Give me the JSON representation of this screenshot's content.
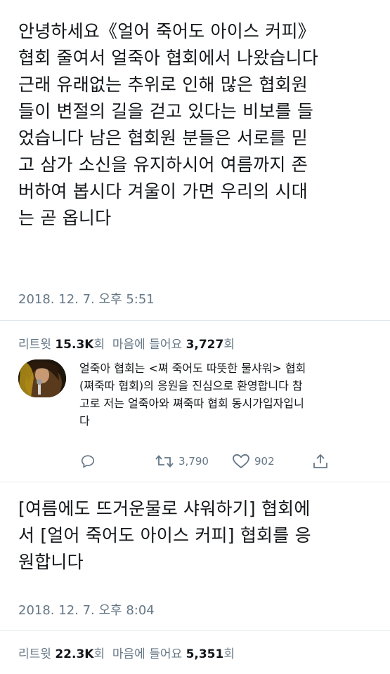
{
  "tweet1": {
    "lines": [
      "안녕하세요《얼어 죽어도 아이스 커피》",
      "협회 줄여서 얼죽아 협회에서 나왔습니다",
      "근래 유래없는 추위로 인해 많은 협회원",
      "들이 변절의 길을 걷고 있다는 비보를 들",
      "었습니다 남은 협회원 분들은 서로를 믿",
      "고 삼가 소신을 유지하시어 여름까지 존",
      "버하여 봅시다 겨울이 가면 우리의 시대",
      "는 곧 옵니다"
    ],
    "timestamp": "2018. 12. 7. 오후 5:51",
    "retweet_label": "리트윗",
    "retweet_count": "15.3K",
    "count_suffix": "회",
    "like_label": "마음에 들어요",
    "like_count": "3,727"
  },
  "reply": {
    "lines": [
      "얼죽아 협회는 <쪄 죽어도 따뜻한 물샤워> 협회",
      "(쪄죽따 협회)의 응원을 진심으로 환영합니다 참",
      "고로 저는 얼죽아와 쪄죽따 협회 동시가입자입니",
      "다"
    ],
    "retweets": "3,790",
    "likes": "902",
    "icons": [
      "reply-icon",
      "retweet-icon",
      "heart-icon",
      "share-icon"
    ]
  },
  "tweet2": {
    "lines": [
      "[여름에도 뜨거운물로 샤워하기] 협회에",
      "서 [얼어 죽어도 아이스 커피] 협회를 응",
      "원합니다"
    ],
    "timestamp": "2018. 12. 7. 오후 8:04",
    "retweet_label": "리트윗",
    "retweet_count": "22.3K",
    "count_suffix": "회",
    "like_label": "마음에 들어요",
    "like_count": "5,351"
  },
  "colors": {
    "text": "#14171a",
    "secondary": "#657786",
    "divider": "#e1e8ed"
  }
}
